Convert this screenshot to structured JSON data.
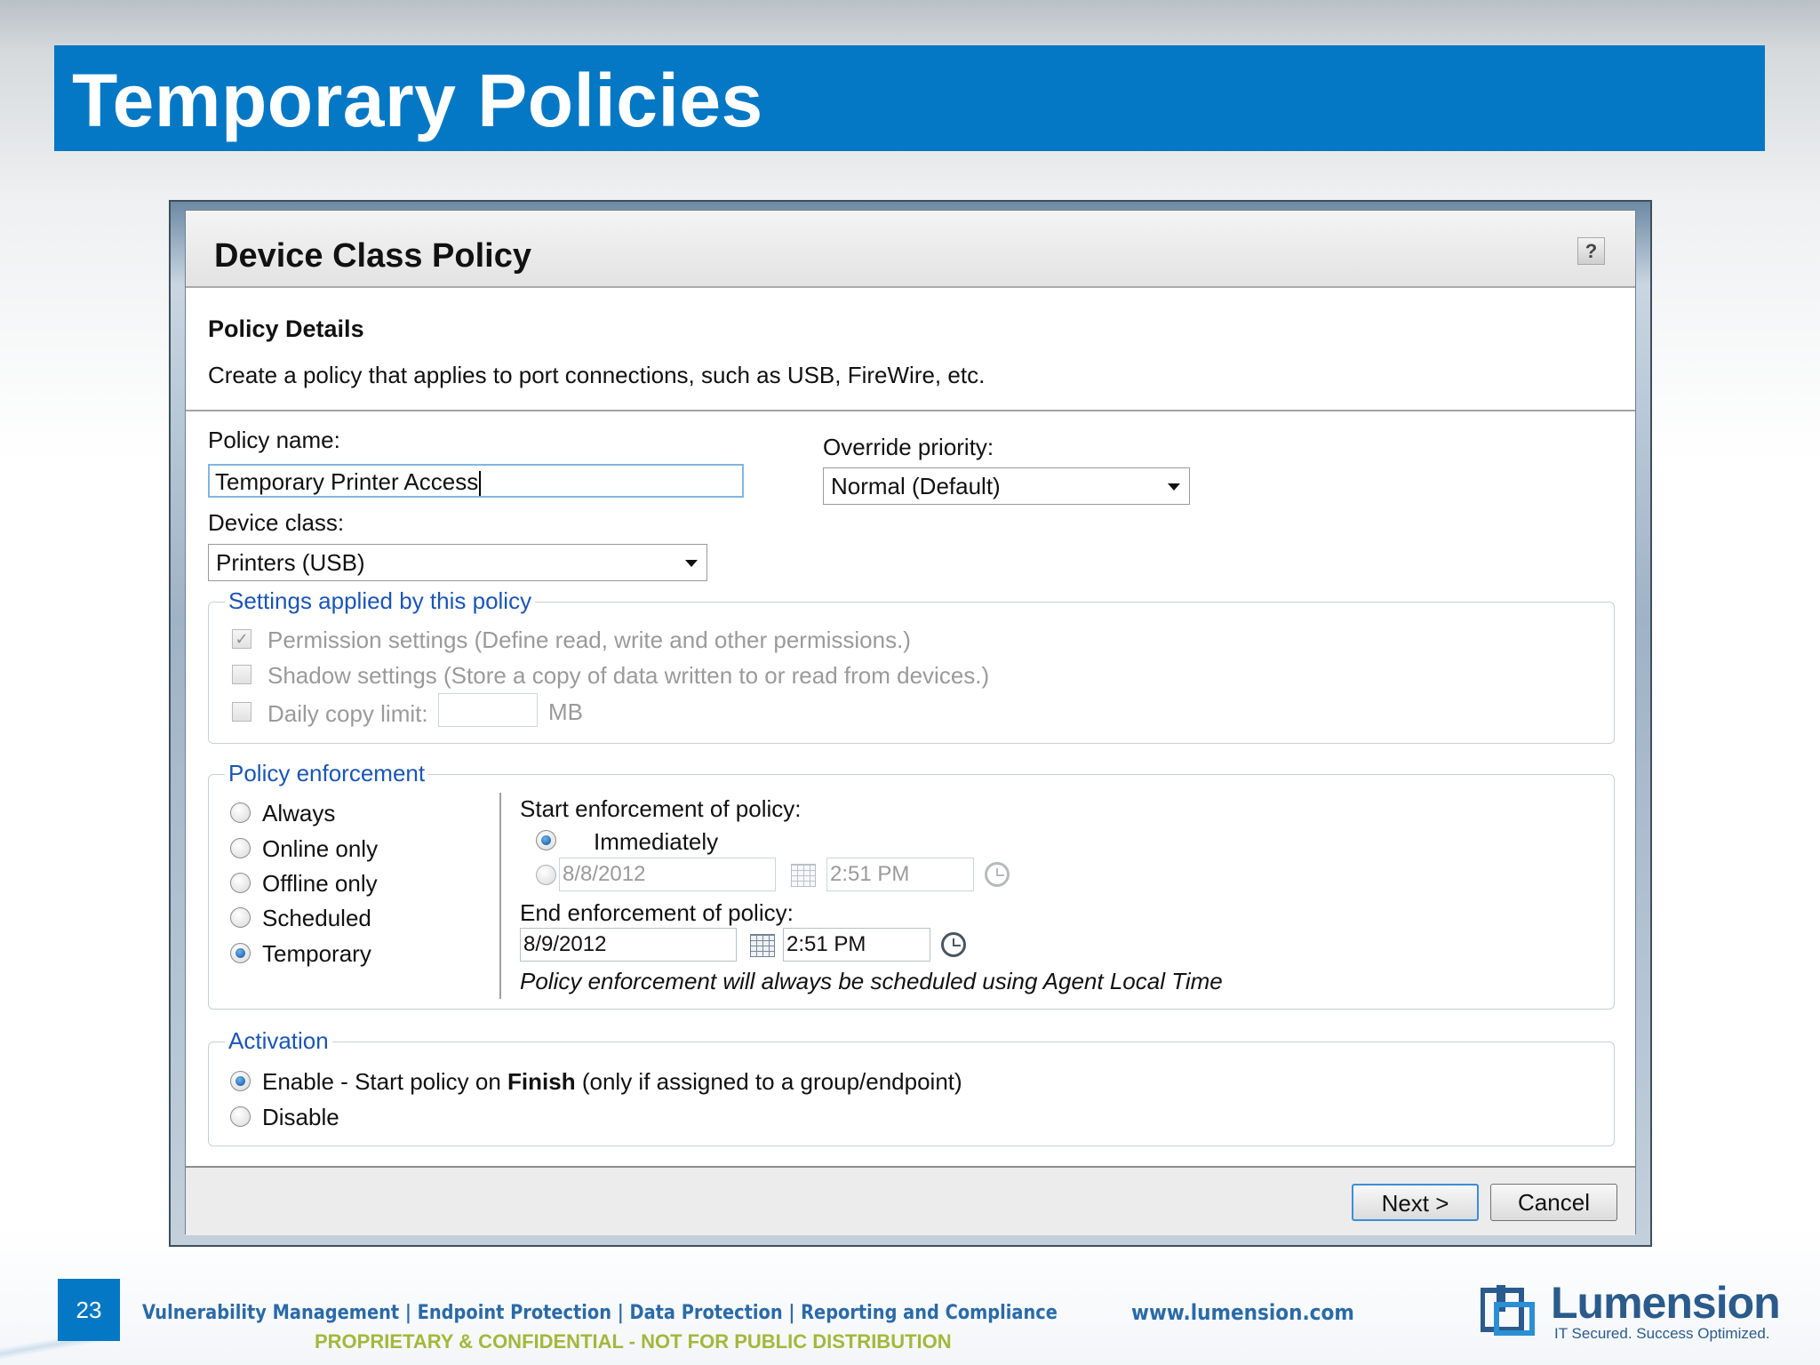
{
  "slide": {
    "title": "Temporary Policies",
    "page_number": "23",
    "footer_tagline": "Vulnerability Management | Endpoint Protection | Data Protection | Reporting and Compliance",
    "footer_confidential": "PROPRIETARY & CONFIDENTIAL - NOT FOR PUBLIC DISTRIBUTION",
    "footer_url": "www.lumension.com",
    "logo_name": "Lumension",
    "logo_tagline": "IT Secured. Success Optimized."
  },
  "dialog": {
    "title": "Device Class Policy",
    "help_label": "?",
    "details_title": "Policy Details",
    "details_desc": "Create a policy that applies to port connections, such as USB, FireWire, etc.",
    "policy_name_label": "Policy name:",
    "policy_name_value": "Temporary Printer Access",
    "override_priority_label": "Override priority:",
    "override_priority_value": "Normal (Default)",
    "device_class_label": "Device class:",
    "device_class_value": "Printers (USB)",
    "settings": {
      "legend": "Settings applied by this policy",
      "permission": "Permission settings (Define read, write and other permissions.)",
      "permission_checked": true,
      "shadow": "Shadow settings (Store a copy of data written to or read from devices.)",
      "daily_limit": "Daily copy limit:",
      "daily_limit_unit": "MB"
    },
    "enforcement": {
      "legend": "Policy enforcement",
      "options": [
        "Always",
        "Online only",
        "Offline only",
        "Scheduled",
        "Temporary"
      ],
      "selected": "Temporary",
      "start_label": "Start enforcement of policy:",
      "start_immediately": "Immediately",
      "start_date": "8/8/2012",
      "start_time": "2:51 PM",
      "end_label": "End enforcement of policy:",
      "end_date": "8/9/2012",
      "end_time": "2:51 PM",
      "note": "Policy enforcement will always be scheduled using Agent Local Time"
    },
    "activation": {
      "legend": "Activation",
      "enable_prefix": "Enable - Start policy on ",
      "enable_bold": "Finish",
      "enable_suffix": " (only if assigned to a group/endpoint)",
      "disable": "Disable"
    },
    "buttons": {
      "next": "Next >",
      "cancel": "Cancel"
    }
  }
}
